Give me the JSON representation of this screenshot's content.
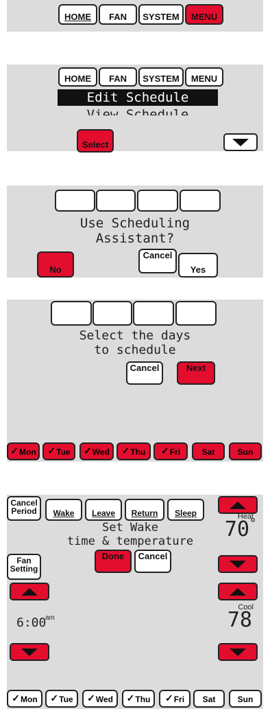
{
  "panel1": {
    "nav": [
      "HOME",
      "FAN",
      "SYSTEM",
      "MENU"
    ]
  },
  "panel2": {
    "nav": [
      "HOME",
      "FAN",
      "SYSTEM",
      "MENU"
    ],
    "selected_item": "Edit Schedule",
    "next_item": "View Schedule",
    "select_label": "Select",
    "down_icon": "down-arrow-icon"
  },
  "panel3": {
    "prompt_line1": "Use Scheduling",
    "prompt_line2": "Assistant?",
    "no_label": "No",
    "cancel_label": "Cancel",
    "yes_label": "Yes"
  },
  "panel4": {
    "prompt_line1": "Select the days",
    "prompt_line2": "to schedule",
    "cancel_label": "Cancel",
    "next_label": "Next",
    "days": [
      "Mon",
      "Tue",
      "Wed",
      "Thu",
      "Fri",
      "Sat",
      "Sun"
    ],
    "check": "✓"
  },
  "panel5": {
    "cancel_period_l1": "Cancel",
    "cancel_period_l2": "Period",
    "periods": [
      "Wake",
      "Leave",
      "Return",
      "Sleep"
    ],
    "prompt_line1": "Set Wake",
    "prompt_line2": "time & temperature",
    "done_label": "Done",
    "cancel_label": "Cancel",
    "fan_l1": "Fan",
    "fan_l2": "Setting",
    "heat_label": "Heat",
    "heat_value": "70",
    "degree": "°",
    "cool_label": "Cool",
    "cool_value": "78",
    "time_value": "6:00",
    "time_suffix": "am",
    "days": [
      "Mon",
      "Tue",
      "Wed",
      "Thu",
      "Fri",
      "Sat",
      "Sun"
    ],
    "check": "✓"
  },
  "colors": {
    "accent_red": "#e30d2e",
    "panel_gray": "#dcdcdc"
  }
}
